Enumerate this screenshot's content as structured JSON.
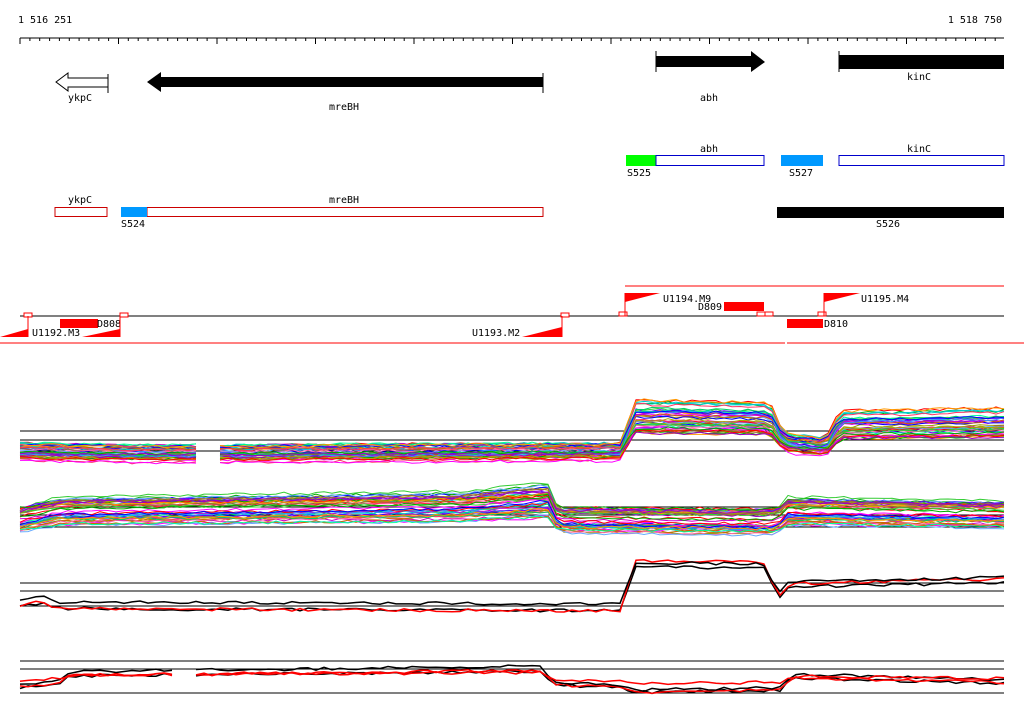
{
  "ruler": {
    "start_label": "1 516 251",
    "end_label": "1 518 750"
  },
  "genes": [
    {
      "name": "ykpC",
      "strand": "-",
      "style": "outline"
    },
    {
      "name": "mreBH",
      "strand": "-",
      "style": "filled"
    },
    {
      "name": "abh",
      "strand": "+",
      "style": "filled"
    },
    {
      "name": "kinC",
      "strand": "+",
      "style": "filled"
    }
  ],
  "transcripts_forward": [
    {
      "label": "abh",
      "segment_label": "S525",
      "segment_color": "#00ff00",
      "box_color": "#0000cc"
    },
    {
      "label": "",
      "segment_label": "S527",
      "segment_color": "#0099ff",
      "box_color": ""
    },
    {
      "label": "kinC",
      "segment_label": "",
      "segment_color": "",
      "box_color": "#0000cc"
    }
  ],
  "transcripts_reverse": [
    {
      "label": "ykpC",
      "segment_label": "",
      "segment_color": "",
      "box_color": "#cc0000"
    },
    {
      "label": "mreBH",
      "segment_label": "S524",
      "segment_color": "#0099ff",
      "box_color": "#cc0000"
    },
    {
      "label": "",
      "segment_label": "S526",
      "segment_color": "#000000",
      "box_color": ""
    }
  ],
  "upshifts": [
    {
      "label": "U1192.M3"
    },
    {
      "label": "U1193.M2"
    },
    {
      "label": "U1194.M9"
    },
    {
      "label": "U1195.M4"
    }
  ],
  "downshifts": [
    {
      "label": "D808"
    },
    {
      "label": "D809"
    },
    {
      "label": "D810"
    }
  ],
  "colors": {
    "gene": "#000000",
    "forward_box": "#0000cc",
    "reverse_box": "#cc0000",
    "shift": "#ff0000",
    "highlight_series": "#ff0000"
  }
}
